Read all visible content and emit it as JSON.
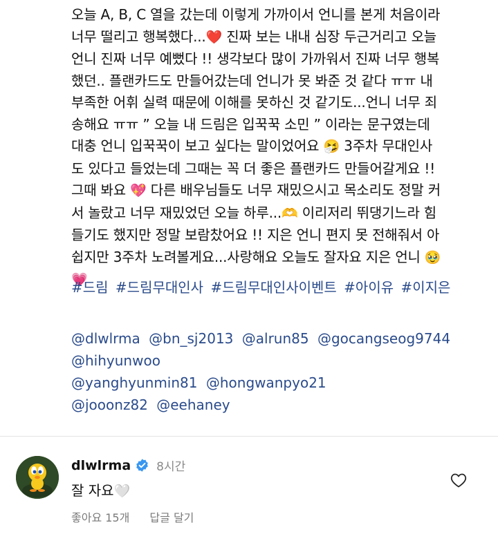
{
  "caption": {
    "lines": [
      "오늘 A, B, C 열을 갔는데 이렇게 가까이서 언니를 본게 처음이라",
      "너무 떨리고 행복했다...",
      " 진짜 보는 내내 심장 두근거리고 오늘",
      "언니 진짜 너무 예뻤다 !! 생각보다 많이 가까워서 진짜 너무 행복",
      "했던.. 플랜카드도 만들어갔는데 언니가 못 봐준 것 같다 ㅠㅠ 내",
      "부족한 어휘 실력 때문에 이해를 못하신 것 같기도...언니 너무 죄",
      "송해요 ㅠㅠ ” 오늘 내 드림은 입꾹꾹 소민 ” 이라는 문구였는데",
      "대충 언니 입꾹꾹이 보고 싶다는 말이었어요",
      " 3주차 무대인사",
      "도 있다고 들었는데 그때는 꼭 더 좋은 플랜카드 만들어갈게요 !!",
      "그때 봐요",
      " 다른 배우님들도 너무 재밌으시고 목소리도 정말 커",
      "서 놀랐고 너무 재밌었던 오늘 하루...",
      " 이리저리 뛰댕기느라 힘",
      "들기도 했지만 정말 보람찼어요 !! 지은 언니 편지 못 전해줘서 아",
      "쉽지만 3주차 노려볼게요...사랑해요 오늘도 잘자요 지은 언니"
    ],
    "emojis": [
      "❤️",
      "🤧",
      "💖",
      "🫶",
      "🥹",
      "💗"
    ]
  },
  "hashtags": [
    "#드림",
    "#드림무대인사",
    "#드림무대인사이벤트",
    "#아이유",
    "#이지은"
  ],
  "mentions": [
    "@dlwlrma",
    "@bn_sj2013",
    "@alrun85",
    "@gocangseog9744",
    "@hihyunwoo",
    "@yanghyunmin81",
    "@hongwanpyo21",
    "@jooonz82",
    "@eehaney"
  ],
  "comment": {
    "username": "dlwlrma",
    "time": "8시간",
    "text": "잘 자요",
    "text_emoji": "🤍",
    "likes": "좋아요 15개",
    "reply_label": "답글 달기"
  },
  "colors": {
    "link": "#2a4b8b",
    "verified": "#3897f0"
  },
  "icons": {
    "verified": "verified-badge-icon",
    "like": "heart-outline-icon",
    "avatar": "tweety-bird-avatar"
  }
}
